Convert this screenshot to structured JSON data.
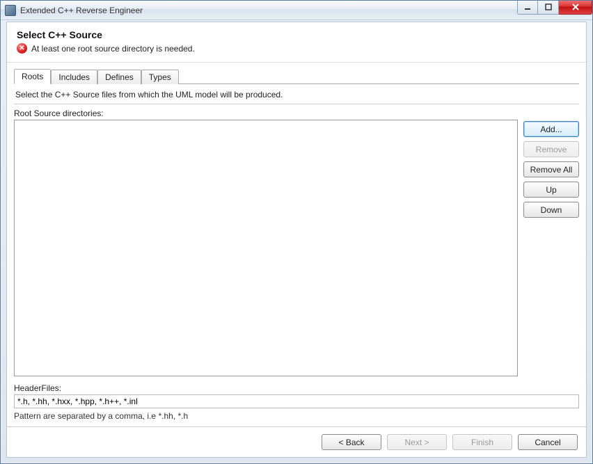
{
  "window": {
    "title": "Extended C++ Reverse Engineer"
  },
  "header": {
    "title": "Select C++ Source",
    "error": "At least one root source directory is needed."
  },
  "tabs": [
    {
      "label": "Roots"
    },
    {
      "label": "Includes"
    },
    {
      "label": "Defines"
    },
    {
      "label": "Types"
    }
  ],
  "roots_panel": {
    "instruction": "Select the C++ Source files from which the UML model will be produced.",
    "list_label": "Root Source directories:",
    "buttons": {
      "add": "Add...",
      "remove": "Remove",
      "remove_all": "Remove All",
      "up": "Up",
      "down": "Down"
    },
    "header_files_label": "HeaderFiles:",
    "header_files_value": "*.h, *.hh, *.hxx, *.hpp, *.h++, *.inl",
    "pattern_hint": "Pattern are separated by a comma, i.e *.hh, *.h"
  },
  "footer": {
    "back": "< Back",
    "next": "Next >",
    "finish": "Finish",
    "cancel": "Cancel"
  }
}
